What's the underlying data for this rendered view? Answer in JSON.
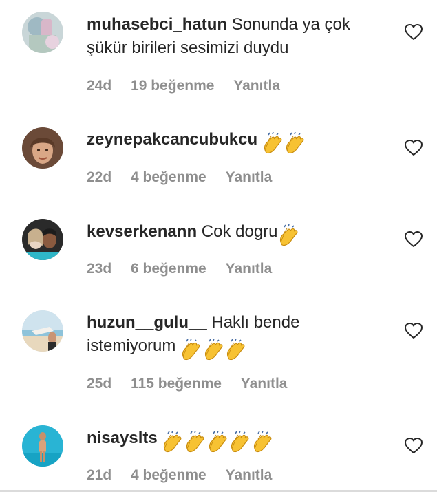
{
  "comments": [
    {
      "username": "muhasebci_hatun",
      "text": "Sonunda ya çok şükür birileri sesimizi duydu",
      "time": "24d",
      "likes": "19 beğenme",
      "reply": "Yanıtla",
      "avatar": "avatar-photo-muhasebci",
      "claps": 0
    },
    {
      "username": "zeynepakcancubukcu",
      "text": "",
      "time": "22d",
      "likes": "4 beğenme",
      "reply": "Yanıtla",
      "avatar": "avatar-photo-zeynep",
      "claps": 2
    },
    {
      "username": "kevserkenann",
      "text": "Cok dogru",
      "time": "23d",
      "likes": "6 beğenme",
      "reply": "Yanıtla",
      "avatar": "avatar-photo-kevser",
      "claps": 1
    },
    {
      "username": "huzun__gulu__",
      "text": "Haklı bende istemiyorum",
      "time": "25d",
      "likes": "115 beğenme",
      "reply": "Yanıtla",
      "avatar": "avatar-photo-huzun",
      "claps": 3
    },
    {
      "username": "nisayslts",
      "text": "",
      "time": "21d",
      "likes": "4 beğenme",
      "reply": "Yanıtla",
      "avatar": "avatar-photo-nisa",
      "claps": 5
    }
  ],
  "icons": {
    "like": "heart-outline-icon",
    "emoji": "clapping-hands-emoji"
  },
  "colors": {
    "text": "#262626",
    "secondary": "#8e8e8e",
    "divider": "#dbdbdb",
    "emoji": "#f7c233"
  }
}
